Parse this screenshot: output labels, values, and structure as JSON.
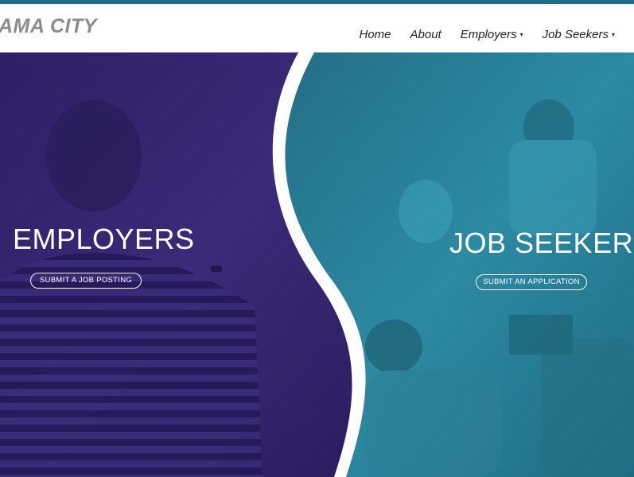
{
  "colors": {
    "brand_teal": "#1a6f8f",
    "employers_overlay": "#3b2a78",
    "seekers_overlay": "#2c8aa3",
    "logo_gray": "#8c8c8c",
    "nav_text": "#222222"
  },
  "header": {
    "logo_text": "AMA CITY",
    "nav": [
      {
        "label": "Home",
        "has_dropdown": false
      },
      {
        "label": "About",
        "has_dropdown": false
      },
      {
        "label": "Employers",
        "has_dropdown": true
      },
      {
        "label": "Job Seekers",
        "has_dropdown": true
      }
    ],
    "caret_glyph": "▾"
  },
  "hero": {
    "employers": {
      "title": "EMPLOYERS",
      "cta_label": "SUBMIT A JOB POSTING"
    },
    "job_seekers": {
      "title": "JOB SEEKERS",
      "cta_label": "SUBMIT AN APPLICATION"
    }
  }
}
